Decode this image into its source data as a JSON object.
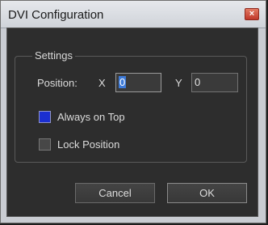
{
  "window": {
    "title": "DVI Configuration",
    "close_symbol": "×"
  },
  "settings_group": {
    "label": "Settings",
    "position_label": "Position:",
    "x_label": "X",
    "x_value": "0",
    "y_label": "Y",
    "y_value": "0"
  },
  "options": {
    "always_on_top": {
      "label": "Always on Top",
      "checked": true
    },
    "lock_position": {
      "label": "Lock Position",
      "checked": false
    }
  },
  "buttons": {
    "cancel": "Cancel",
    "ok": "OK"
  },
  "colors": {
    "client_bg": "#2d2d2d",
    "checkbox_checked": "#1b2fd1",
    "selection": "#3d7ad8",
    "close_button": "#c0392b"
  }
}
